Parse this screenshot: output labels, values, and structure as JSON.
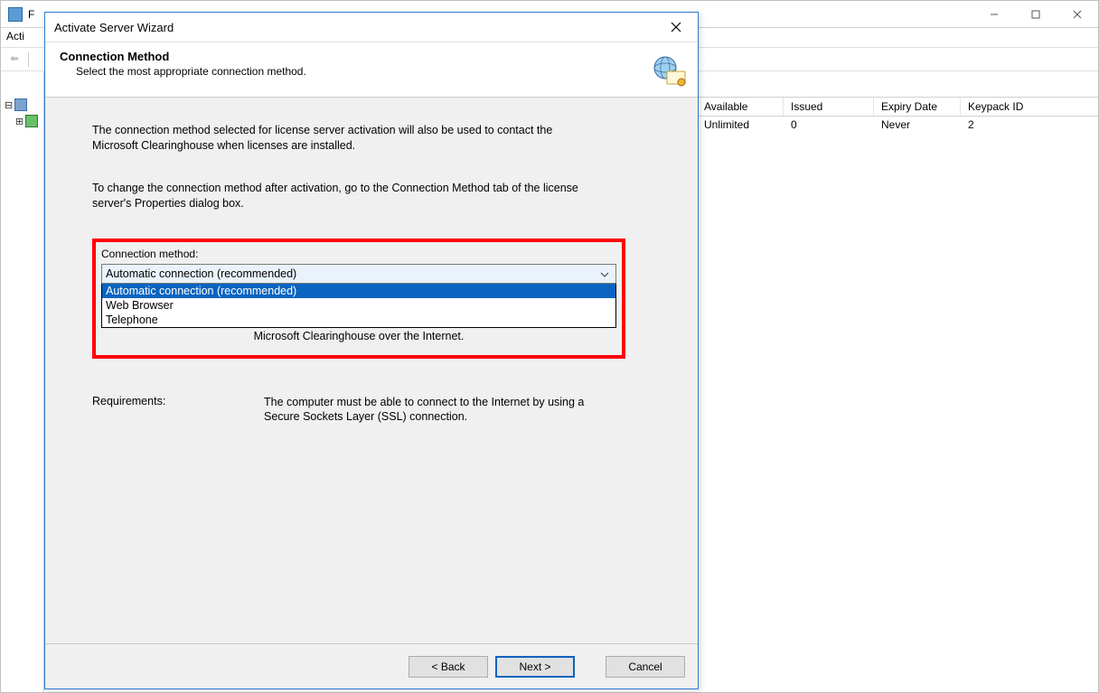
{
  "main_window": {
    "menu_file_partial": "Acti",
    "columns": {
      "available": "Available",
      "issued": "Issued",
      "expiry": "Expiry Date",
      "keypack": "Keypack ID"
    },
    "row": {
      "available": "Unlimited",
      "issued": "0",
      "expiry": "Never",
      "keypack": "2"
    }
  },
  "wizard": {
    "title": "Activate Server Wizard",
    "header_title": "Connection Method",
    "header_sub": "Select the most appropriate connection method.",
    "para1": "The connection method selected for license server activation will also be used to contact the Microsoft Clearinghouse when licenses are installed.",
    "para2": "To change the connection method after activation, go to the Connection Method tab of the license server's Properties dialog box.",
    "conn_label": "Connection method:",
    "dropdown_selected": "Automatic connection (recommended)",
    "dropdown_options": [
      "Automatic connection (recommended)",
      "Web Browser",
      "Telephone"
    ],
    "behind_dropdown_text": "Microsoft Clearinghouse over the Internet.",
    "requirements_label": "Requirements:",
    "requirements_text": "The computer must be able to connect to the Internet by using a Secure Sockets Layer (SSL) connection.",
    "back": "< Back",
    "next": "Next >",
    "cancel": "Cancel"
  }
}
